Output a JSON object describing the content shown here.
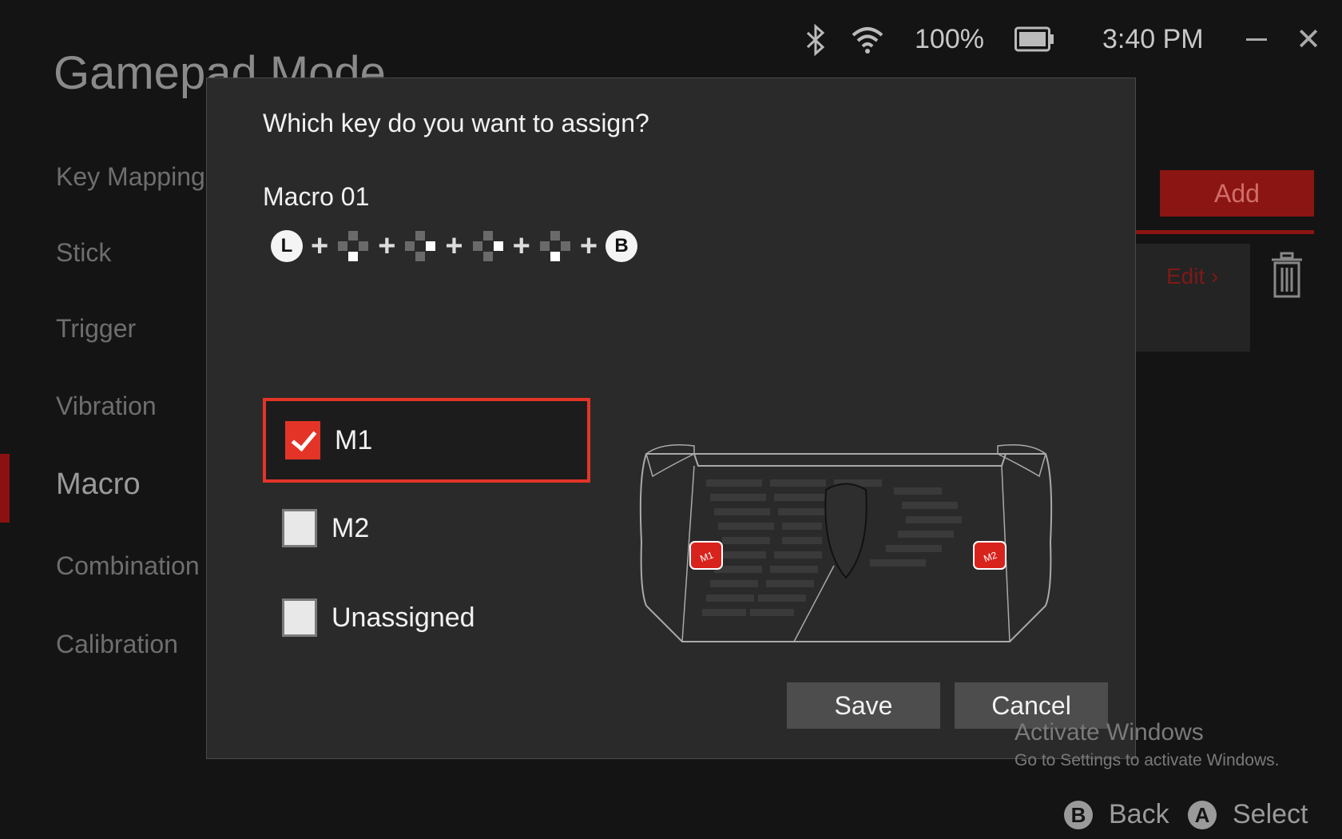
{
  "status_bar": {
    "battery_percent": "100%",
    "time": "3:40 PM",
    "icons": [
      "bluetooth-icon",
      "wifi-icon",
      "battery-icon",
      "minimize-icon",
      "close-icon"
    ]
  },
  "app": {
    "title": "Gamepad Mode",
    "nav": [
      {
        "label": "Key Mapping"
      },
      {
        "label": "Stick"
      },
      {
        "label": "Trigger"
      },
      {
        "label": "Vibration"
      },
      {
        "label": "Macro"
      },
      {
        "label": "Combination "
      },
      {
        "label": "Calibration"
      }
    ],
    "active_nav": "Macro",
    "add_label": "Add",
    "edit_label": "Edit",
    "accent_color": "#8b1512"
  },
  "dialog": {
    "question": "Which key do you want to assign?",
    "macro_name": "Macro 01",
    "macro_sequence": [
      "L",
      "+",
      "dpad-down",
      "+",
      "dpad-right",
      "+",
      "dpad-right",
      "+",
      "dpad-down",
      "+",
      "B"
    ],
    "options": [
      {
        "label": "M1",
        "checked": true
      },
      {
        "label": "M2",
        "checked": false
      },
      {
        "label": "Unassigned",
        "checked": false
      }
    ],
    "device_buttons": [
      "M1",
      "M2"
    ],
    "save_label": "Save",
    "cancel_label": "Cancel",
    "highlight_color": "#e43428"
  },
  "watermark": {
    "title": "Activate Windows",
    "subtitle": "Go to Settings to activate Windows."
  },
  "hints": {
    "back_key": "B",
    "back_label": "Back",
    "select_key": "A",
    "select_label": "Select"
  }
}
